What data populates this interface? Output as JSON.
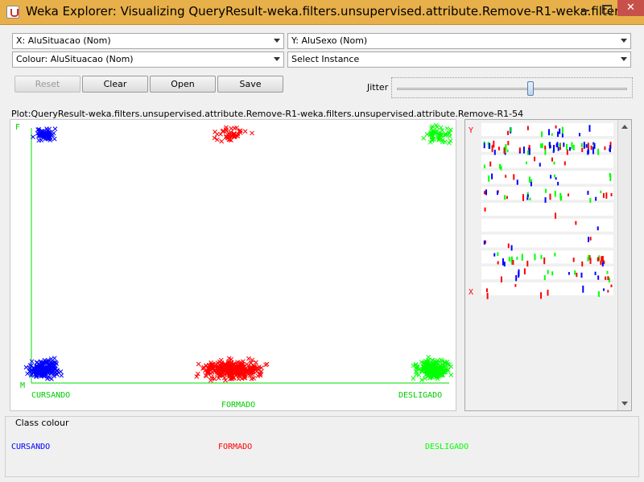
{
  "window": {
    "title": "Weka Explorer: Visualizing QueryResult-weka.filters.unsupervised.attribute.Remove-R1-weka.filters....",
    "close_glyph": "✕"
  },
  "controls": {
    "x_axis": "X: AluSituacao (Nom)",
    "y_axis": "Y: AluSexo (Nom)",
    "colour": "Colour: AluSituacao (Nom)",
    "instance": "Select Instance",
    "reset_label": "Reset",
    "clear_label": "Clear",
    "open_label": "Open",
    "save_label": "Save",
    "jitter_label": "Jitter",
    "jitter_value": 0.58
  },
  "plot": {
    "title": "Plot:QueryResult-weka.filters.unsupervised.attribute.Remove-R1-weka.filters.unsupervised.attribute.Remove-R1-54",
    "y_top_label": "F",
    "y_bottom_label": "M",
    "x_categories": [
      "CURSANDO",
      "FORMADO",
      "DESLIGADO"
    ],
    "axis_color": "#00dd00",
    "clusters": [
      {
        "x": "CURSANDO",
        "y": "F",
        "class": "CURSANDO",
        "count": 60
      },
      {
        "x": "FORMADO",
        "y": "F",
        "class": "FORMADO",
        "count": 45
      },
      {
        "x": "DESLIGADO",
        "y": "F",
        "class": "DESLIGADO",
        "count": 55
      },
      {
        "x": "CURSANDO",
        "y": "M",
        "class": "CURSANDO",
        "count": 180
      },
      {
        "x": "FORMADO",
        "y": "M",
        "class": "FORMADO",
        "count": 320
      },
      {
        "x": "DESLIGADO",
        "y": "M",
        "class": "DESLIGADO",
        "count": 200
      }
    ]
  },
  "attribute_panel": {
    "y_marker": "Y",
    "x_marker": "X",
    "row_count": 11
  },
  "class_colour": {
    "label": "Class colour",
    "classes": [
      {
        "name": "CURSANDO",
        "color": "#0000ff"
      },
      {
        "name": "FORMADO",
        "color": "#ff0000"
      },
      {
        "name": "DESLIGADO",
        "color": "#00ff00"
      }
    ]
  }
}
